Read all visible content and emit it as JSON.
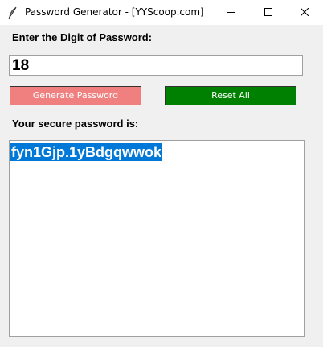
{
  "window": {
    "title": "Password Generator - [YYScoop.com]"
  },
  "form": {
    "prompt_label": "Enter the Digit of Password:",
    "digit_value": "18",
    "generate_label": "Generate Password",
    "reset_label": "Reset All",
    "result_label": "Your secure password is:",
    "password": "fyn1Gjp.1yBdgqwwok"
  },
  "colors": {
    "generate_button": "#f08080",
    "reset_button": "#008000",
    "selection": "#0078d7"
  },
  "icons": {
    "app": "feather-icon",
    "minimize": "minimize-icon",
    "maximize": "maximize-icon",
    "close": "close-icon"
  }
}
